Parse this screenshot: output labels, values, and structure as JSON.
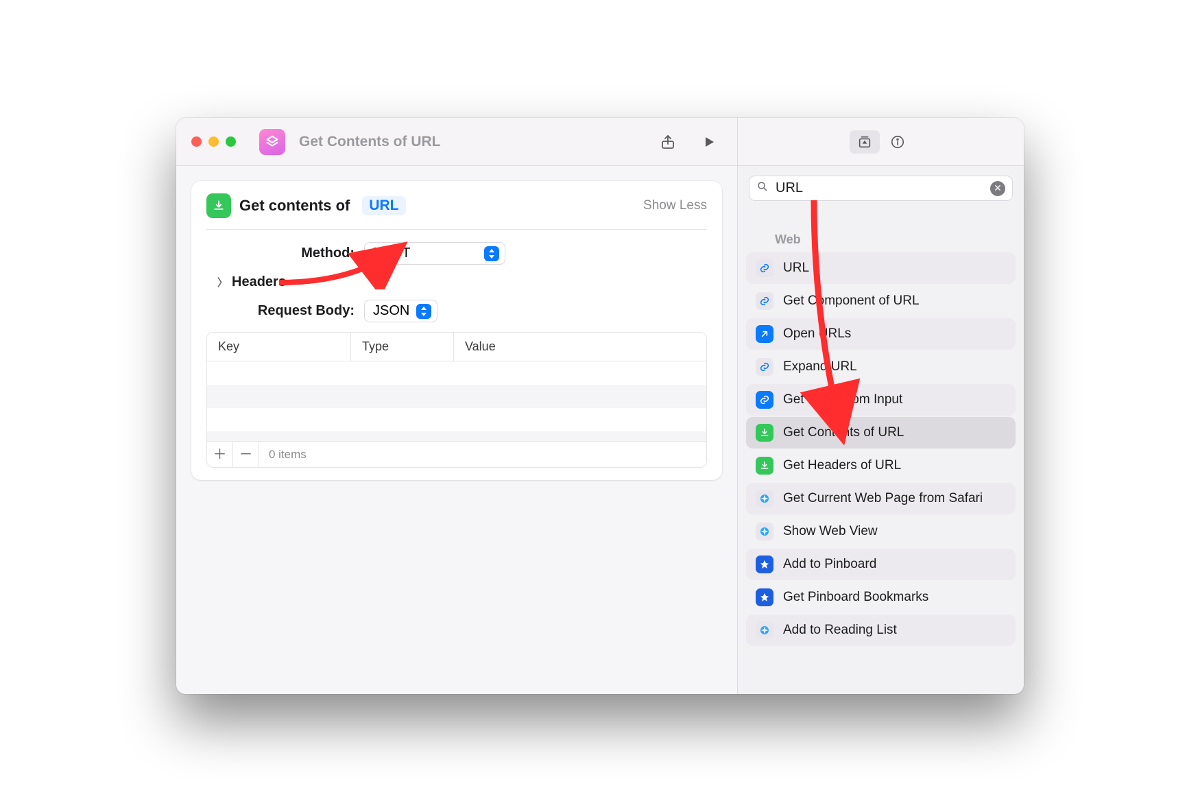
{
  "window": {
    "title": "Get Contents of URL"
  },
  "toolbar": {
    "share": "share",
    "run": "run"
  },
  "inspector": {
    "mode": "library"
  },
  "action": {
    "title_prefix": "Get contents of",
    "url_token": "URL",
    "show_less": "Show Less",
    "method_label": "Method:",
    "method_value": "POST",
    "headers_label": "Headers",
    "body_label": "Request Body:",
    "body_value": "JSON",
    "table": {
      "columns": {
        "key": "Key",
        "type": "Type",
        "value": "Value"
      },
      "count_label": "0 items"
    }
  },
  "search": {
    "value": "URL"
  },
  "library": {
    "section": "Web",
    "items": [
      {
        "label": "URL",
        "icon": "link"
      },
      {
        "label": "Get Component of URL",
        "icon": "link"
      },
      {
        "label": "Open URLs",
        "icon": "open"
      },
      {
        "label": "Expand URL",
        "icon": "link"
      },
      {
        "label": "Get URLs from Input",
        "icon": "link-solid"
      },
      {
        "label": "Get Contents of URL",
        "icon": "download"
      },
      {
        "label": "Get Headers of URL",
        "icon": "download"
      },
      {
        "label": "Get Current Web Page from Safari",
        "icon": "safari"
      },
      {
        "label": "Show Web View",
        "icon": "safari"
      },
      {
        "label": "Add to Pinboard",
        "icon": "pinboard"
      },
      {
        "label": "Get Pinboard Bookmarks",
        "icon": "pinboard"
      },
      {
        "label": "Add to Reading List",
        "icon": "safari"
      }
    ]
  }
}
